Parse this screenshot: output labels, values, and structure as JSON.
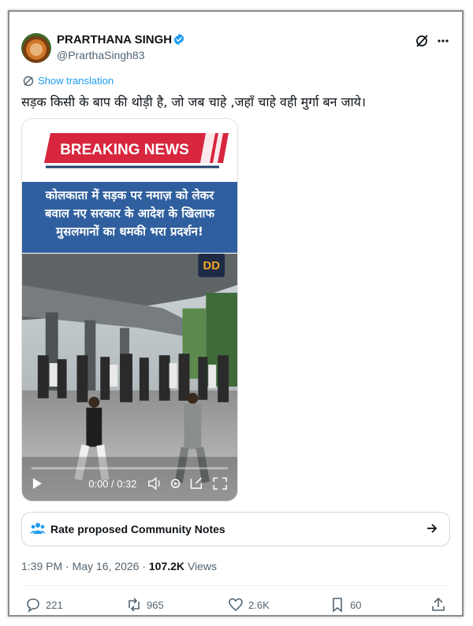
{
  "author": {
    "display_name": "PRARTHANA SINGH",
    "handle": "@PrarthaSingh83"
  },
  "translation_link": "Show translation",
  "tweet_text": "सड़क किसी के बाप की थोड़ी है, जो जब चाहे ,जहाँ चाहे वही मुर्गा बन जाये।",
  "media": {
    "banner_text": "BREAKING NEWS",
    "headline_lines": [
      "कोलकाता में सड़क पर नमाज़ को लेकर",
      "बवाल नए सरकार के आदेश के खिलाफ",
      "मुसलमानों का धमकी भरा प्रदर्शन!"
    ],
    "channel_logo": "DD",
    "player_time": "0:00 / 0:32",
    "progress": 0
  },
  "community_notes": {
    "label": "Rate proposed Community Notes"
  },
  "meta": {
    "time": "1:39 PM",
    "date": "May 16, 2026",
    "views_count": "107.2K",
    "views_label": "Views"
  },
  "actions": {
    "replies": "221",
    "reposts": "965",
    "likes": "2.6K",
    "bookmarks": "60"
  },
  "colors": {
    "accent": "#1d9bf0",
    "breaking_red": "#d7263d",
    "headline_blue": "#2f5f9e"
  }
}
